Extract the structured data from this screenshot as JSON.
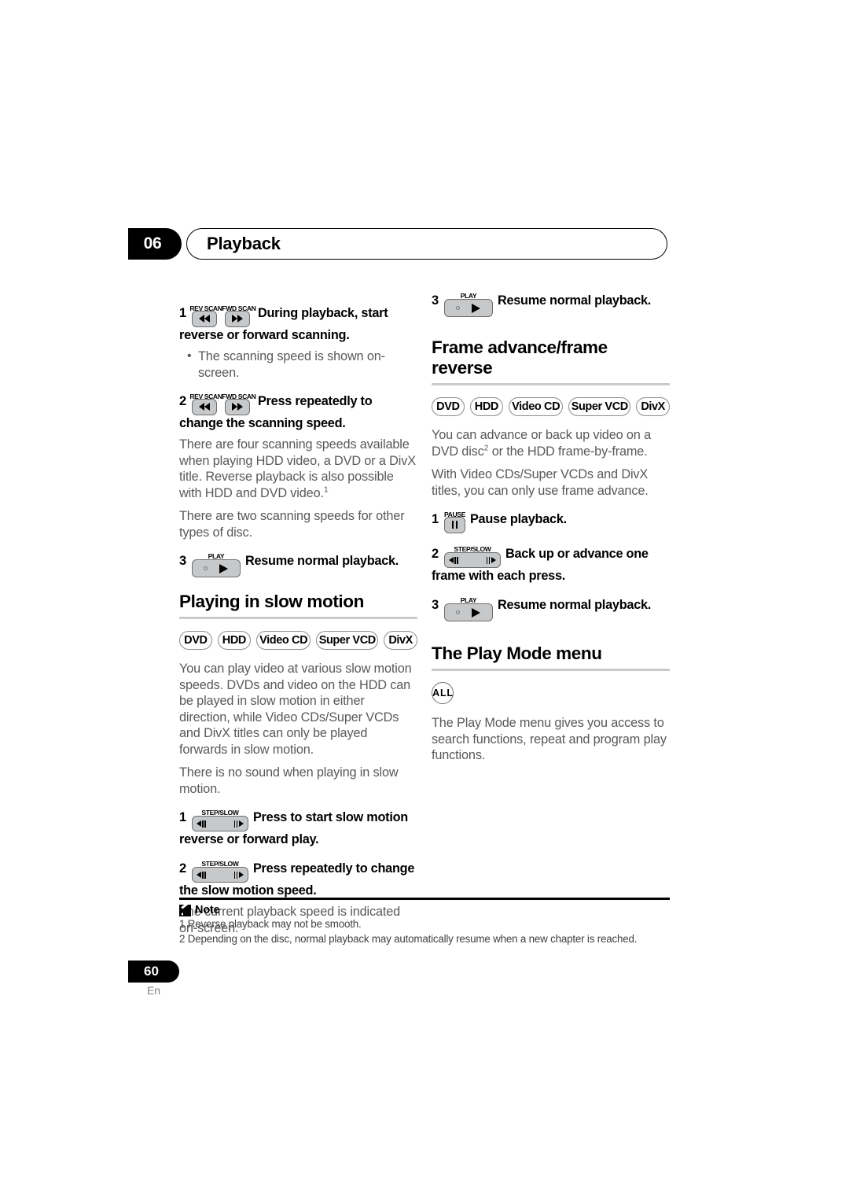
{
  "header": {
    "chapter_number": "06",
    "chapter_title": "Playback"
  },
  "left_column": {
    "step1": {
      "num": "1",
      "key_caption_rev": "REV SCAN",
      "key_caption_fwd": "FWD SCAN",
      "text": "During playback, start reverse or forward scanning."
    },
    "bullet1": "The scanning speed is shown on-screen.",
    "step2": {
      "num": "2",
      "key_caption_rev": "REV SCAN",
      "key_caption_fwd": "FWD SCAN",
      "text": "Press repeatedly to change the scanning speed."
    },
    "para1_a": "There are four scanning speeds available when playing HDD video, a DVD or a DivX title. Reverse playback is also possible with HDD and DVD video.",
    "para1_sup": "1",
    "para2": "There are two scanning speeds for other types of disc.",
    "step3": {
      "num": "3",
      "key_caption": "PLAY",
      "text": "Resume normal playback."
    },
    "section_heading": "Playing in slow motion",
    "disc_badges": [
      "DVD",
      "HDD",
      "Video CD",
      "Super VCD",
      "DivX"
    ],
    "para3": "You can play video at various slow motion speeds. DVDs and video on the HDD can be played in slow motion in either direction, while Video CDs/Super VCDs and DivX titles can only be played forwards in slow motion.",
    "para4": "There is no sound when playing in slow motion.",
    "slow_step1": {
      "num": "1",
      "key_caption": "STEP/SLOW",
      "text": "Press to start slow motion reverse or forward play."
    },
    "slow_step2": {
      "num": "2",
      "key_caption": "STEP/SLOW",
      "text": "Press repeatedly to change the slow motion speed."
    },
    "para5": "The current playback speed is indicated on-screen."
  },
  "right_column": {
    "step3": {
      "num": "3",
      "key_caption": "PLAY",
      "text": "Resume normal playback."
    },
    "section_heading_frame": "Frame advance/frame reverse",
    "disc_badges": [
      "DVD",
      "HDD",
      "Video CD",
      "Super VCD",
      "DivX"
    ],
    "para1_a": "You can advance or back up video on a DVD disc",
    "para1_sup": "2",
    "para1_b": " or the HDD frame-by-frame.",
    "para2": "With Video CDs/Super VCDs and DivX titles, you can only use frame advance.",
    "frame_step1": {
      "num": "1",
      "key_caption": "PAUSE",
      "text": "Pause playback."
    },
    "frame_step2": {
      "num": "2",
      "key_caption": "STEP/SLOW",
      "text": "Back up or advance one frame with each press."
    },
    "frame_step3": {
      "num": "3",
      "key_caption": "PLAY",
      "text": "Resume normal playback."
    },
    "section_heading_playmode": "The Play Mode menu",
    "all_badge": "ALL",
    "para3": "The Play Mode menu gives you access to search functions, repeat and program play functions."
  },
  "note": {
    "label": "Note",
    "items": [
      "1 Reverse playback may not be smooth.",
      "2 Depending on the disc, normal playback may automatically resume when a new chapter is reached."
    ]
  },
  "footer": {
    "page_number": "60",
    "language": "En"
  }
}
